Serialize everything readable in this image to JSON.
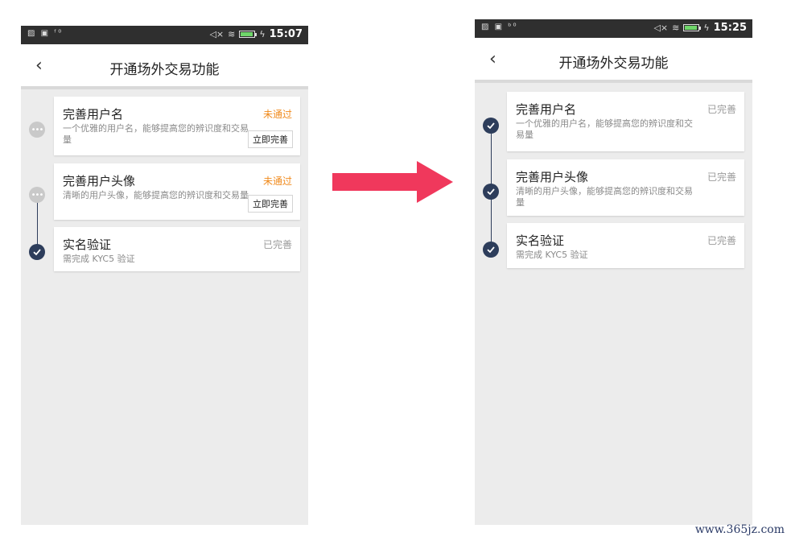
{
  "left": {
    "statusbar": {
      "left_icons": "▨ ▣ ᶠ⁰",
      "time": "15:07",
      "icons": {
        "mute": "mute-icon",
        "wifi": "wifi-icon",
        "battery": "battery-icon",
        "charging": "charging-icon"
      }
    },
    "header": {
      "title": "开通场外交易功能",
      "back_icon": "chevron-left-icon"
    },
    "steps": [
      {
        "title": "完善用户名",
        "desc": "一个优雅的用户名，能够提高您的辨识度和交易量",
        "status": "未通过",
        "button": "立即完善",
        "state": "pending"
      },
      {
        "title": "完善用户头像",
        "desc": "清晰的用户头像，能够提高您的辨识度和交易量",
        "status": "未通过",
        "button": "立即完善",
        "state": "pending"
      },
      {
        "title": "实名验证",
        "desc": "需完成 KYC5 验证",
        "status": "已完善",
        "state": "done"
      }
    ]
  },
  "right": {
    "statusbar": {
      "left_icons": "▨ ▣ ᵇ⁰",
      "time": "15:25",
      "icons": {
        "mute": "mute-icon",
        "wifi": "wifi-icon",
        "battery": "battery-icon",
        "charging": "charging-icon"
      }
    },
    "header": {
      "title": "开通场外交易功能",
      "back_icon": "chevron-left-icon"
    },
    "steps": [
      {
        "title": "完善用户名",
        "desc": "一个优雅的用户名，能够提高您的辨识度和交易量",
        "status": "已完善",
        "state": "done"
      },
      {
        "title": "完善用户头像",
        "desc": "清晰的用户头像，能够提高您的辨识度和交易量",
        "status": "已完善",
        "state": "done"
      },
      {
        "title": "实名验证",
        "desc": "需完成 KYC5 验证",
        "status": "已完善",
        "state": "done"
      }
    ]
  },
  "arrow_color": "#f0385c",
  "colors": {
    "fail": "#f08a1c",
    "done_node": "#2d3d5b",
    "pending_node": "#c9c9c9"
  },
  "watermark": "www.365jz.com"
}
